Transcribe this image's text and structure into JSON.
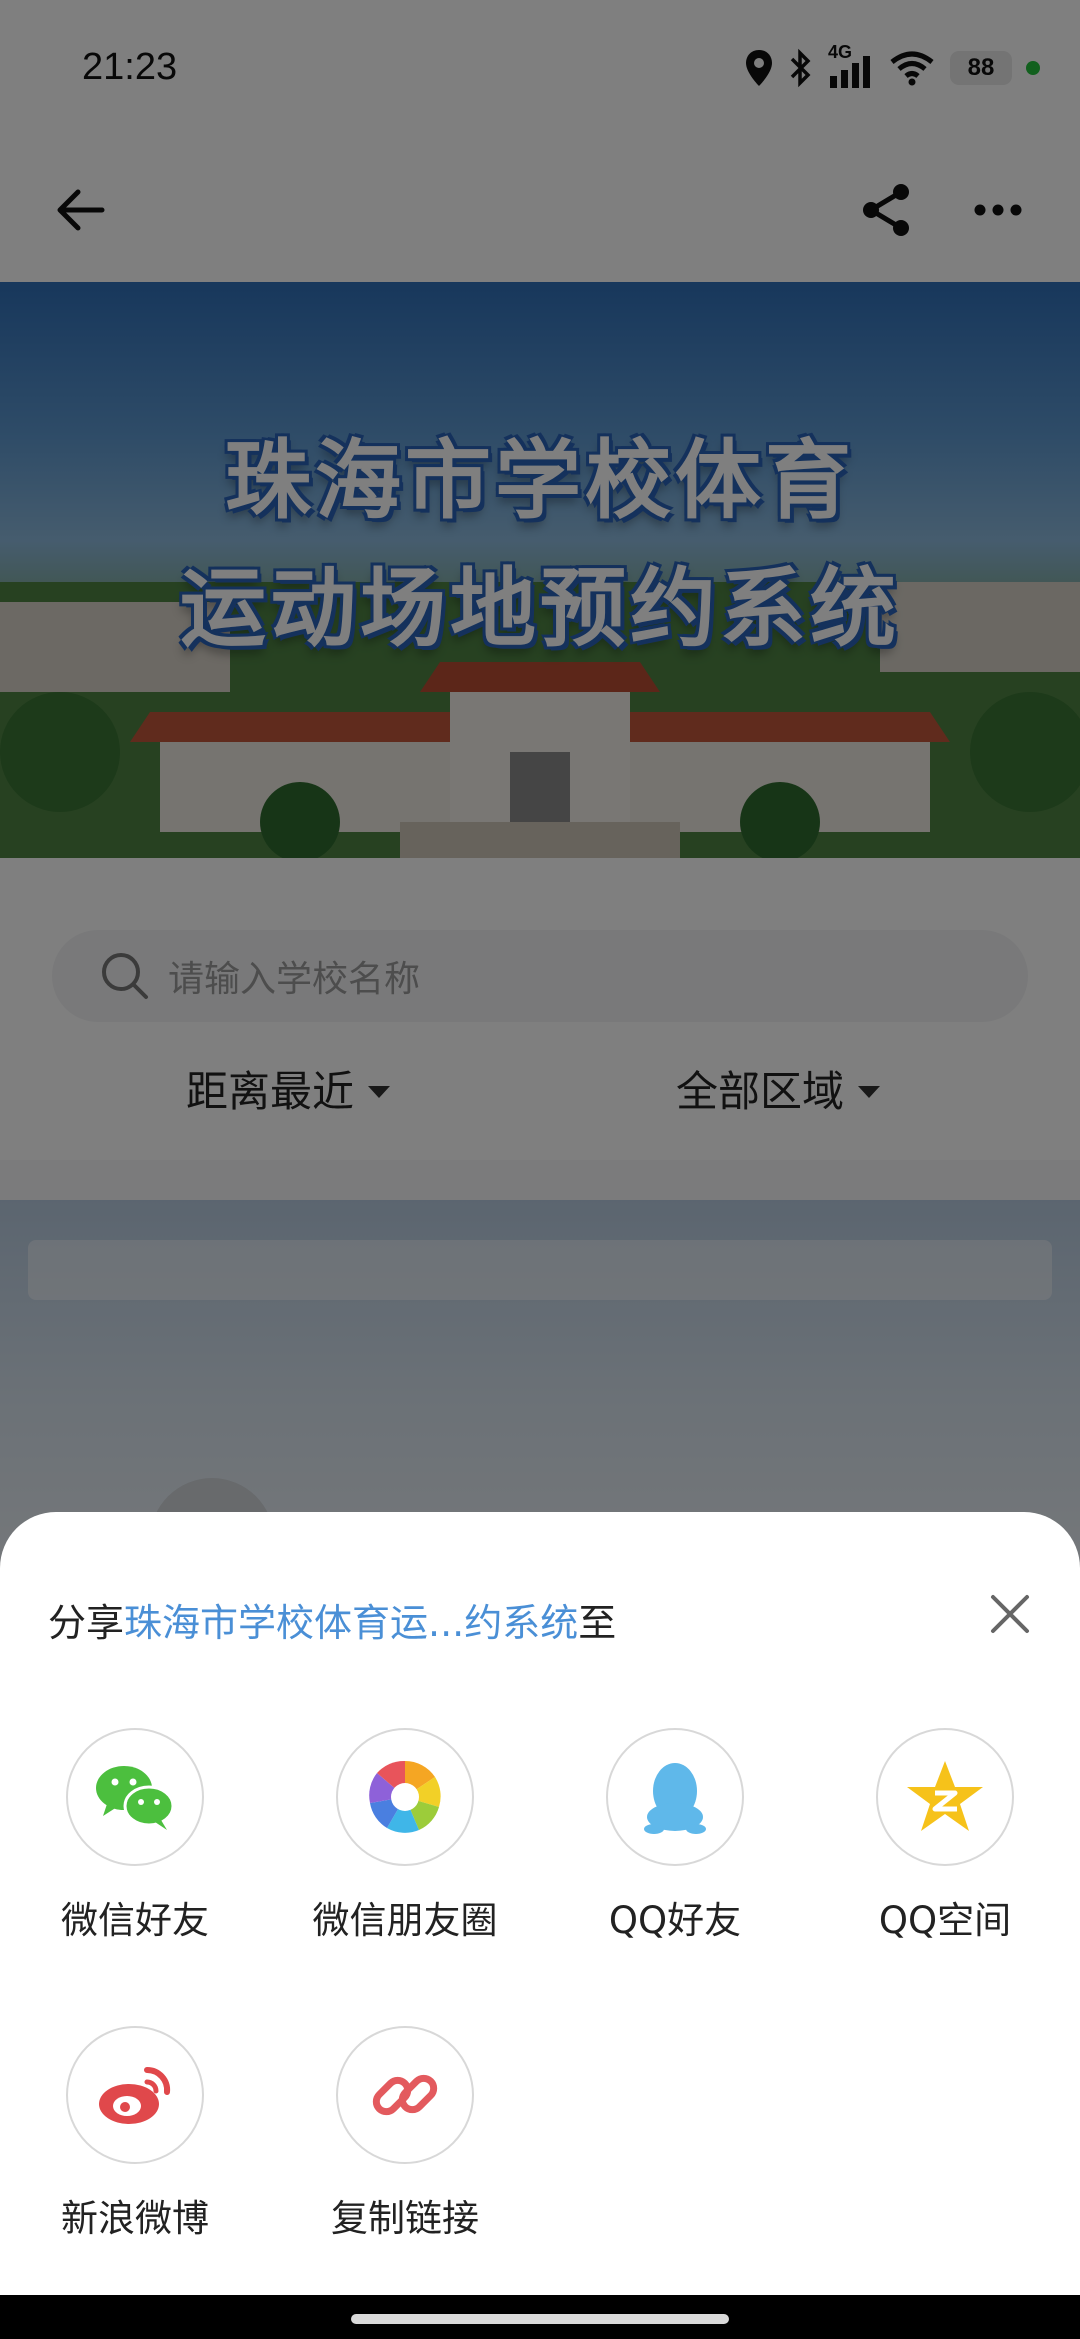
{
  "status_bar": {
    "time": "21:23",
    "network_label": "4G",
    "battery": "88"
  },
  "nav": {
    "back_icon": "arrow-left-icon",
    "share_icon": "share-icon",
    "more_icon": "more-dots-icon"
  },
  "banner": {
    "line1": "珠海市学校体育",
    "line2": "运动场地预约系统"
  },
  "search": {
    "placeholder": "请输入学校名称"
  },
  "filters": [
    {
      "label": "距离最近"
    },
    {
      "label": "全部区域"
    }
  ],
  "share_sheet": {
    "title_prefix": "分享",
    "title_highlight": "珠海市学校体育运...约系统",
    "title_suffix": "至",
    "highlight_color": "#4a8fd6",
    "items": [
      {
        "label": "微信好友",
        "icon": "wechat-icon",
        "color": "#4cbf3e"
      },
      {
        "label": "微信朋友圈",
        "icon": "wechat-moments-icon",
        "color": "#f5a623"
      },
      {
        "label": "QQ好友",
        "icon": "qq-icon",
        "color": "#5fb8ea"
      },
      {
        "label": "QQ空间",
        "icon": "qzone-icon",
        "color": "#f6c21a"
      },
      {
        "label": "新浪微博",
        "icon": "weibo-icon",
        "color": "#e0484b"
      },
      {
        "label": "复制链接",
        "icon": "link-icon",
        "color": "#e35a5e"
      }
    ]
  }
}
